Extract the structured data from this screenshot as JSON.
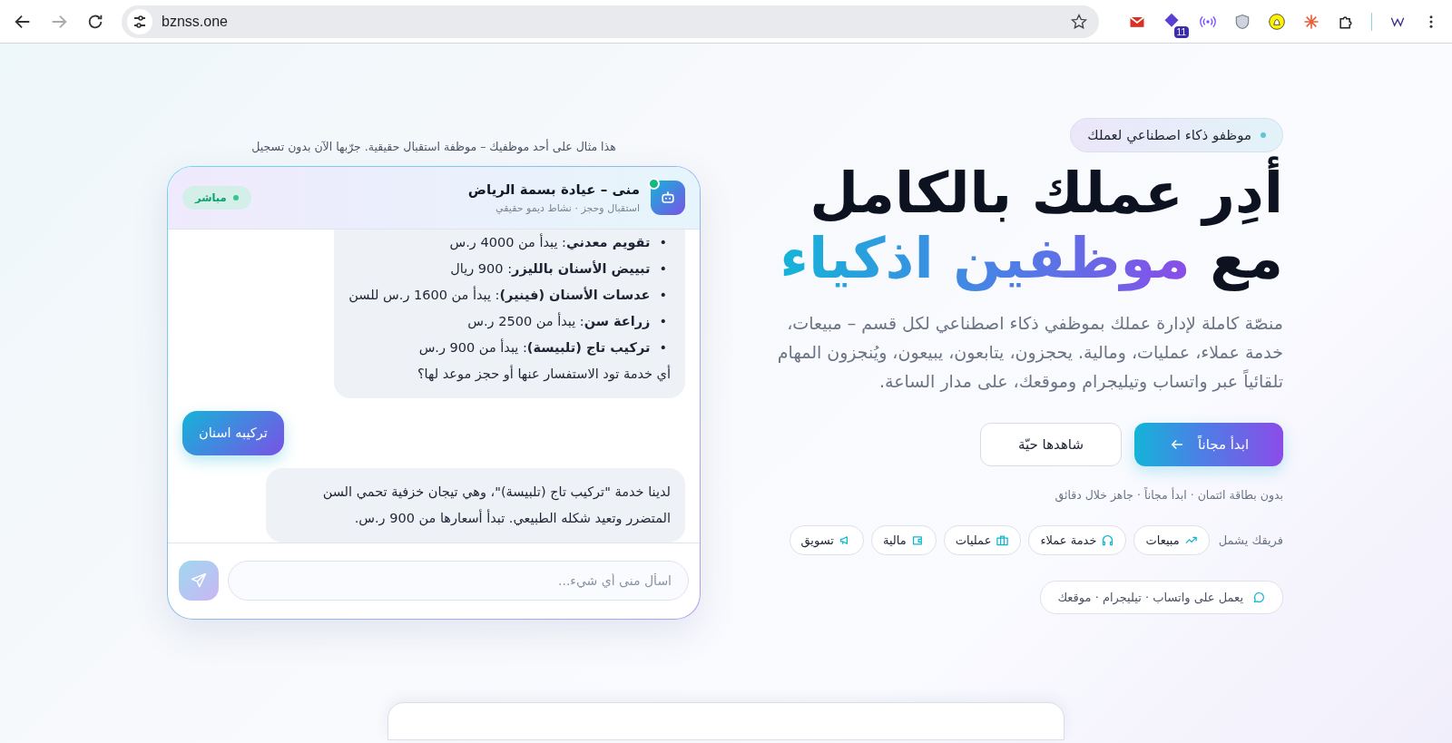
{
  "browser": {
    "url": "bznss.one",
    "extension_badge": "11"
  },
  "hero": {
    "badge": "موظفو ذكاء اصطناعي لعملك",
    "title_line1": "أدِر عملك بالكامل",
    "title_line2_start": "مع",
    "title_line2_highlight": "موظفين اذكياء",
    "description": "منصّة كاملة لإدارة عملك بموظفي ذكاء اصطناعي لكل قسم – مبيعات، خدمة عملاء، عمليات، ومالية. يحجزون، يتابعون، يبيعون، ويُنجزون المهام تلقائياً عبر واتساب وتيليجرام وموقعك، على مدار الساعة.",
    "buttons": [
      {
        "label": "ابدأ مجاناً",
        "kind": "primary"
      },
      {
        "label": "شاهدها حيّة",
        "kind": "secondary"
      }
    ],
    "note": "بدون بطاقة ائتمان · ابدأ مجاناً · جاهز خلال دقائق",
    "team_label": "فريقك يشمل",
    "team": [
      "مبيعات",
      "خدمة عملاء",
      "عمليات",
      "مالية",
      "تسويق"
    ],
    "channels": "يعمل على واتساب · تيليجرام · موقعك"
  },
  "chat": {
    "caption": "هذا مثال على أحد موظفيك – موظفة استقبال حقيقية. جرّبها الآن بدون تسجيل",
    "agent_name": "منى – عيادة بسمة الرياض",
    "agent_subtitle": "استقبال وحجز · نشاط ديمو حقيقي",
    "online": true,
    "status": "مباشر",
    "messages": [
      {
        "kind": "bot",
        "items": [
          {
            "bullet": "•",
            "text": "**تقويم معدني**: يبدأ من 4000 ر.س"
          },
          {
            "bullet": "•",
            "text": "**تبييض الأسنان بالليزر**: 900 ريال"
          },
          {
            "bullet": "•",
            "text": "**عدسات الأسنان (فينير)**: يبدأ من 1600 ر.س للسن"
          },
          {
            "bullet": "•",
            "text": "**زراعة سن**: يبدأ من 2500 ر.س"
          },
          {
            "bullet": "•",
            "text": "**تركيب تاج (تلبيسة)**: يبدأ من 900 ر.س"
          }
        ],
        "text": "أي خدمة تود الاستفسار عنها أو حجز موعد لها؟"
      },
      {
        "kind": "user",
        "text": "تركيبه اسنان"
      },
      {
        "kind": "bot",
        "text": "لدينا خدمة \"تركيب تاج (تلبيسة)\"، وهي تيجان خزفية تحمي السن المتضرر وتعيد شكله الطبيعي. تبدأ أسعارها من 900 ر.س."
      }
    ],
    "placeholder": "اسأل منى أي شيء..."
  }
}
